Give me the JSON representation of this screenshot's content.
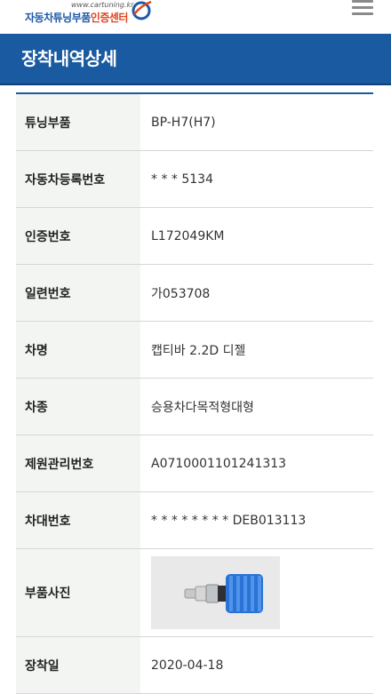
{
  "brand": {
    "url": "www.cartuning.kr",
    "name_main": "자동차튜닝부품",
    "name_accent": "인증센터"
  },
  "header": {
    "title": "장착내역상세"
  },
  "details": [
    {
      "label": "튜닝부품",
      "value": "BP-H7(H7)"
    },
    {
      "label": "자동차등록번호",
      "value": "* * * 5134"
    },
    {
      "label": "인증번호",
      "value": "L172049KM"
    },
    {
      "label": "일련번호",
      "value": "가053708"
    },
    {
      "label": "차명",
      "value": "캡티바 2.2D 디젤"
    },
    {
      "label": "차종",
      "value": "승용차다목적형대형"
    },
    {
      "label": "제원관리번호",
      "value": "A0710001101241313"
    },
    {
      "label": "차대번호",
      "value": "* * * * * * * * DEB013113"
    },
    {
      "label": "부품사진",
      "value": ""
    },
    {
      "label": "장착일",
      "value": "2020-04-18"
    }
  ],
  "colors": {
    "header_bg": "#1a5aa0",
    "label_bg": "#f3f5f3",
    "logo_blue": "#1e5aa8",
    "logo_orange": "#e0451f"
  },
  "icons": {
    "menu": "hamburger-menu-icon",
    "logo": "swoosh-logo-icon"
  }
}
